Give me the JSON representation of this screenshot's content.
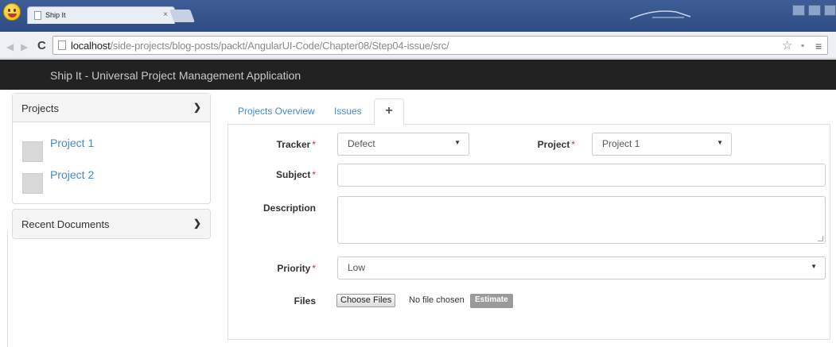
{
  "browser": {
    "tab_title": "Ship It",
    "tab_close": "×",
    "url_host": "localhost",
    "url_path": "/side-projects/blog-posts/packt/AngularUI-Code/Chapter08/Step04-issue/src/"
  },
  "app": {
    "title": "Ship It - Universal Project Management Application"
  },
  "sidebar": {
    "projects_panel": {
      "title": "Projects",
      "items": [
        {
          "label": "Project 1"
        },
        {
          "label": "Project 2"
        }
      ]
    },
    "recent_panel": {
      "title": "Recent Documents"
    }
  },
  "tabs": [
    {
      "label": "Projects Overview"
    },
    {
      "label": "Issues"
    },
    {
      "label": "+"
    }
  ],
  "form": {
    "tracker": {
      "label": "Tracker",
      "value": "Defect"
    },
    "project": {
      "label": "Project",
      "value": "Project 1"
    },
    "subject": {
      "label": "Subject",
      "value": ""
    },
    "description": {
      "label": "Description",
      "value": ""
    },
    "priority": {
      "label": "Priority",
      "value": "Low"
    },
    "files": {
      "label": "Files",
      "button": "Choose Files",
      "status": "No file chosen"
    },
    "estimate_button": "Estimate",
    "required_marker": "*"
  },
  "colors": {
    "link": "#428bca",
    "appbar": "#222222",
    "required": "#c9302c"
  }
}
